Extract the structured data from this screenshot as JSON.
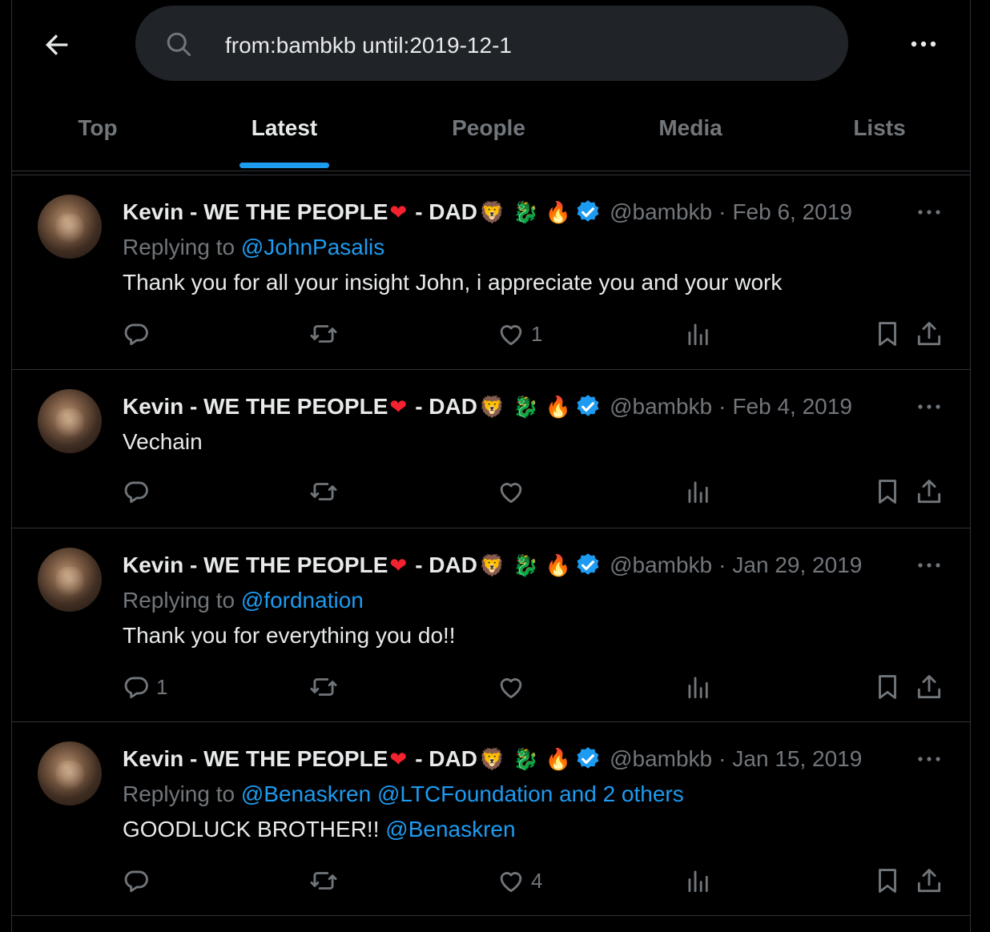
{
  "search": {
    "query": "from:bambkb until:2019-12-1"
  },
  "tabs": [
    {
      "label": "Top"
    },
    {
      "label": "Latest"
    },
    {
      "label": "People"
    },
    {
      "label": "Media"
    },
    {
      "label": "Lists"
    }
  ],
  "active_tab": "Latest",
  "colors": {
    "accent": "#1d9bf0",
    "muted": "#71767b",
    "text": "#e7e9ea",
    "background": "#000000"
  },
  "tweets": [
    {
      "name": "Kevin - WE THE PEOPLE",
      "dad": "- DAD",
      "handle": "@bambkb",
      "date": "Feb 6, 2019",
      "replying_prefix": "Replying to",
      "replying_to": "@JohnPasalis",
      "text": "Thank you for all your insight John, i appreciate you and your work",
      "replies": "",
      "likes": "1"
    },
    {
      "name": "Kevin - WE THE PEOPLE",
      "dad": "- DAD",
      "handle": "@bambkb",
      "date": "Feb 4, 2019",
      "text": "Vechain",
      "replies": "",
      "likes": ""
    },
    {
      "name": "Kevin - WE THE PEOPLE",
      "dad": "- DAD",
      "handle": "@bambkb",
      "date": "Jan 29, 2019",
      "replying_prefix": "Replying to",
      "replying_to": "@fordnation",
      "text": "Thank you for everything you do!!",
      "replies": "1",
      "likes": ""
    },
    {
      "name": "Kevin - WE THE PEOPLE",
      "dad": "- DAD",
      "handle": "@bambkb",
      "date": "Jan 15, 2019",
      "replying_prefix": "Replying to",
      "replying_to": "@Benaskren @LTCFoundation and 2 others",
      "text": "GOODLUCK BROTHER!!",
      "text_mention": "@Benaskren",
      "replies": "",
      "likes": "4"
    }
  ],
  "icons": [
    "back-arrow-icon",
    "search-icon",
    "more-icon",
    "verified-badge-icon",
    "reply-icon",
    "retweet-icon",
    "like-icon",
    "views-icon",
    "bookmark-icon",
    "share-icon"
  ]
}
